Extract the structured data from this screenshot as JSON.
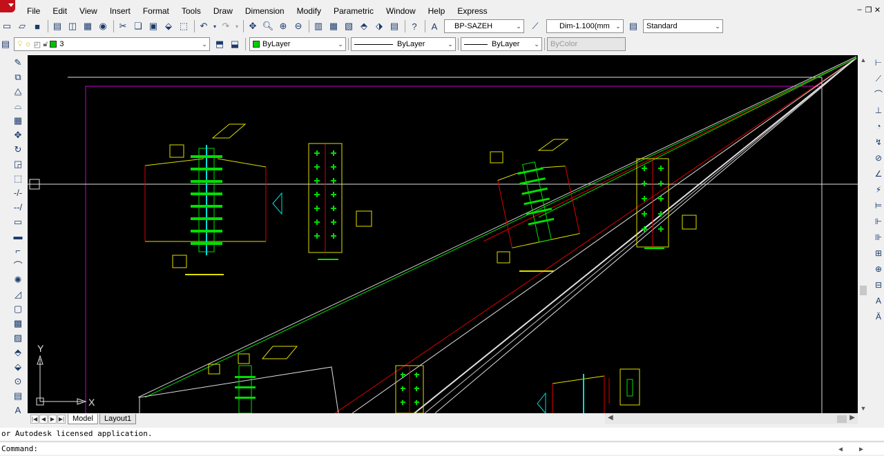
{
  "menu": {
    "items": [
      "File",
      "Edit",
      "View",
      "Insert",
      "Format",
      "Tools",
      "Draw",
      "Dimension",
      "Modify",
      "Parametric",
      "Window",
      "Help",
      "Express"
    ]
  },
  "toolbar": {
    "text_style": "BP-SAZEH",
    "dim_style": "Dim-1.100(mm",
    "table_style": "Standard",
    "layer": "3",
    "color": "ByLayer",
    "linetype": "ByLayer",
    "lineweight": "ByLayer",
    "plot_style": "ByColor"
  },
  "colors": {
    "layer_green": "#00c000",
    "color_green": "#00d000"
  },
  "tabs": [
    "Model",
    "Layout1"
  ],
  "ucs": {
    "x_label": "X",
    "y_label": "Y"
  },
  "command": {
    "history": "or Autodesk licensed application.",
    "prompt": "Command:"
  }
}
